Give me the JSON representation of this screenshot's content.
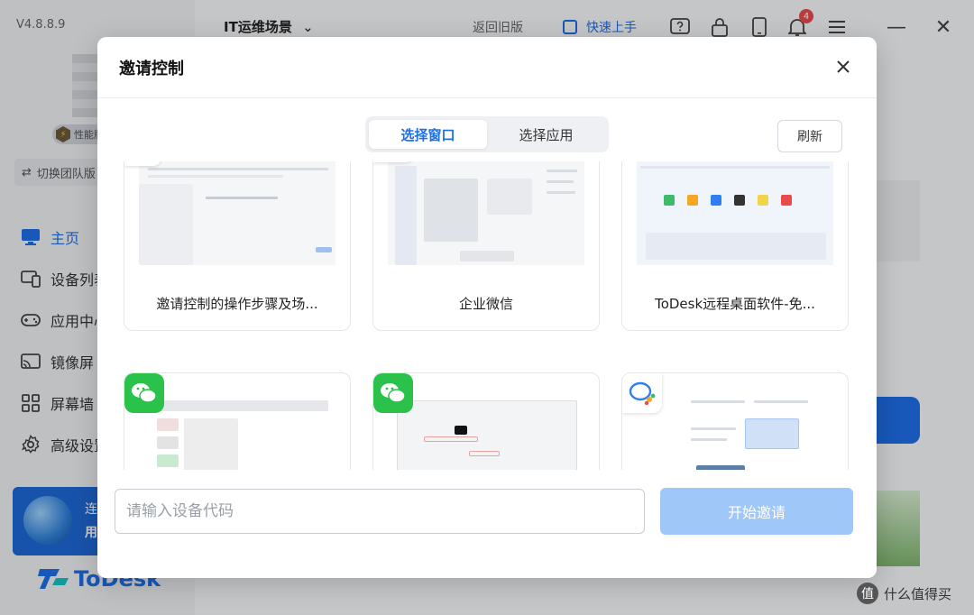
{
  "app": {
    "version": "V4.8.8.9",
    "scene_title": "IT运维场景",
    "back_old": "返回旧版",
    "quick_start": "快速上手",
    "notification_count": "4",
    "perf_badge": "性能版",
    "switch_team": "切换团队版",
    "nav": [
      {
        "label": "主页",
        "icon": "monitor-icon",
        "active": true
      },
      {
        "label": "设备列表",
        "icon": "devices-icon"
      },
      {
        "label": "应用中心",
        "icon": "gamepad-icon"
      },
      {
        "label": "镜像屏",
        "icon": "cast-icon"
      },
      {
        "label": "屏幕墙",
        "icon": "grid-icon"
      },
      {
        "label": "高级设置",
        "icon": "gear-icon"
      }
    ],
    "promo": {
      "line1": "连",
      "line2": "用"
    },
    "brand": "ToDesk"
  },
  "modal": {
    "title": "邀请控制",
    "tabs": [
      {
        "label": "选择窗口",
        "active": true
      },
      {
        "label": "选择应用",
        "active": false
      }
    ],
    "refresh_label": "刷新",
    "cards": [
      {
        "label": "邀请控制的操作步骤及场...",
        "badge": "doc-icon"
      },
      {
        "label": "企业微信",
        "badge": "wecom-icon"
      },
      {
        "label": "ToDesk远程桌面软件-免...",
        "badge": "edge-icon"
      },
      {
        "label": "",
        "badge": "wechat-icon"
      },
      {
        "label": "",
        "badge": "wechat-icon"
      },
      {
        "label": "",
        "badge": "wecom-icon"
      }
    ],
    "input_placeholder": "请输入设备代码",
    "start_label": "开始邀请"
  },
  "watermark": "什么值得买",
  "colors": {
    "accent": "#1e6fe8",
    "start_disabled": "#9fc7f8",
    "wechat": "#2bc24c"
  }
}
